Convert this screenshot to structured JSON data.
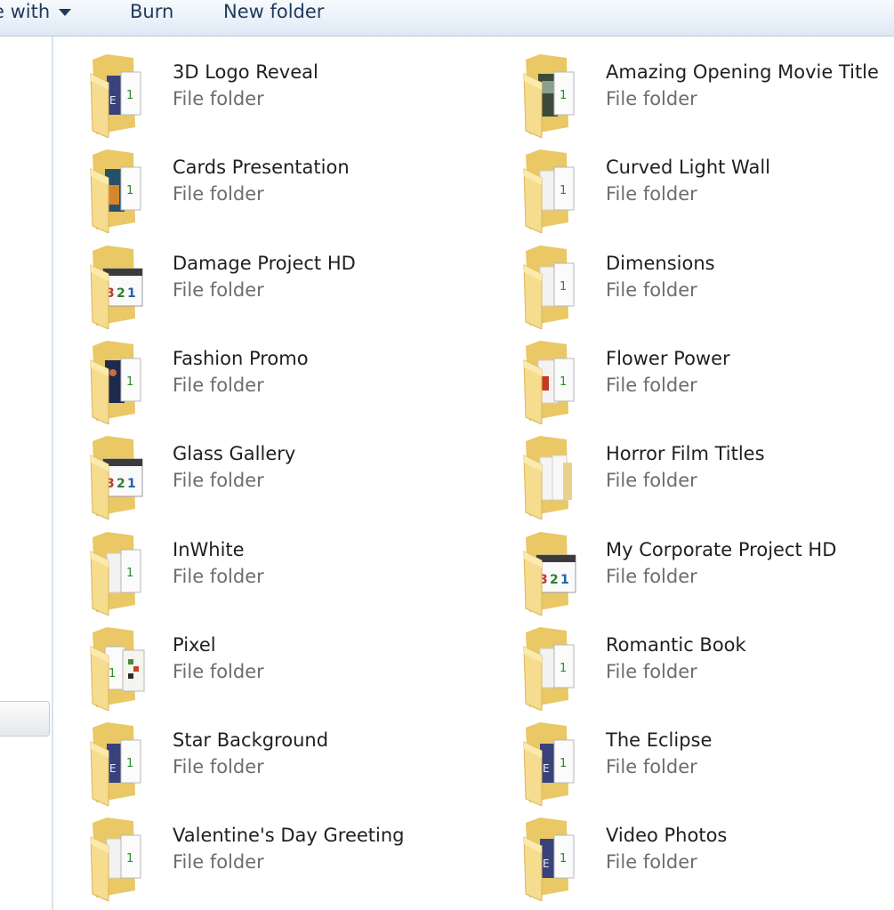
{
  "toolbar": {
    "share_label": "e with",
    "burn_label": "Burn",
    "new_folder_label": "New folder"
  },
  "files": [
    {
      "name": "3D Logo Reveal",
      "type": "File folder",
      "thumb": "ae-blue"
    },
    {
      "name": "Amazing Opening Movie Title",
      "type": "File folder",
      "thumb": "photo-dark"
    },
    {
      "name": "Cards Presentation",
      "type": "File folder",
      "thumb": "photo-orange"
    },
    {
      "name": "Curved Light Wall",
      "type": "File folder",
      "thumb": "ae-white"
    },
    {
      "name": "Damage Project HD",
      "type": "File folder",
      "thumb": "clapper-321"
    },
    {
      "name": "Dimensions",
      "type": "File folder",
      "thumb": "ae-white"
    },
    {
      "name": "Fashion Promo",
      "type": "File folder",
      "thumb": "photo-night"
    },
    {
      "name": "Flower Power",
      "type": "File folder",
      "thumb": "photo-red"
    },
    {
      "name": "Glass Gallery",
      "type": "File folder",
      "thumb": "clapper-321"
    },
    {
      "name": "Horror Film Titles",
      "type": "File folder",
      "thumb": "plain"
    },
    {
      "name": "InWhite",
      "type": "File folder",
      "thumb": "ae-white"
    },
    {
      "name": "My Corporate Project HD",
      "type": "File folder",
      "thumb": "clapper-321"
    },
    {
      "name": "Pixel",
      "type": "File folder",
      "thumb": "photo-pixel"
    },
    {
      "name": "Romantic Book",
      "type": "File folder",
      "thumb": "ae-white"
    },
    {
      "name": "Star Background",
      "type": "File folder",
      "thumb": "ae-blue"
    },
    {
      "name": "The Eclipse",
      "type": "File folder",
      "thumb": "ae-blue"
    },
    {
      "name": "Valentine's Day Greeting",
      "type": "File folder",
      "thumb": "ae-white"
    },
    {
      "name": "Video Photos",
      "type": "File folder",
      "thumb": "ae-blue"
    }
  ]
}
